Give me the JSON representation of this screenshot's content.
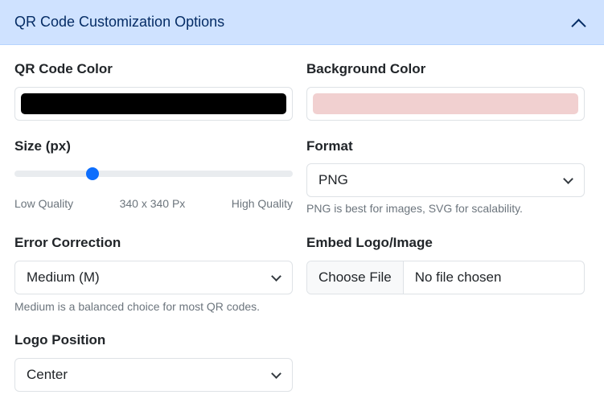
{
  "header": {
    "title": "QR Code Customization Options",
    "toggle_icon": "chevron-up-icon"
  },
  "qr_color": {
    "label": "QR Code Color",
    "value": "#000000"
  },
  "bg_color": {
    "label": "Background Color",
    "value": "#f1d0d0"
  },
  "size": {
    "label": "Size (px)",
    "low_label": "Low Quality",
    "value_text": "340 x 340 Px",
    "high_label": "High Quality",
    "fraction": 0.28
  },
  "format": {
    "label": "Format",
    "selected": "PNG",
    "help": "PNG is best for images, SVG for scalability."
  },
  "error_correction": {
    "label": "Error Correction",
    "selected": "Medium (M)",
    "help": "Medium is a balanced choice for most QR codes."
  },
  "logo": {
    "label": "Embed Logo/Image",
    "button_label": "Choose File",
    "file_status": "No file chosen"
  },
  "logo_position": {
    "label": "Logo Position",
    "selected": "Center"
  }
}
